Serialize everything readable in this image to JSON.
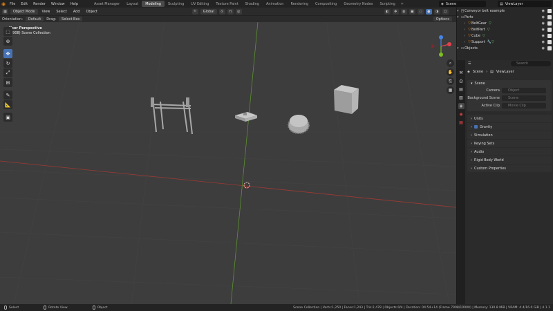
{
  "menu": [
    "File",
    "Edit",
    "Render",
    "Window",
    "Help"
  ],
  "workspaces": [
    "Asset Manager",
    "Layout",
    "Modeling",
    "Sculpting",
    "UV Editing",
    "Texture Paint",
    "Shading",
    "Animation",
    "Rendering",
    "Compositing",
    "Geometry Nodes",
    "Scripting"
  ],
  "active_workspace": "Modeling",
  "scene_name": "Scene",
  "view_layer": "ViewLayer",
  "viewport": {
    "mode": "Object Mode",
    "menus": [
      "View",
      "Select",
      "Add",
      "Object"
    ],
    "orientation_label": "Orientation:",
    "orientation_value": "Default",
    "drag_label": "Drag:",
    "drag_value": "Select Box",
    "transform_orientation": "Global",
    "options": "Options",
    "perspective": "User Perspective",
    "collection": "(7908) Scene Collection"
  },
  "outliner": {
    "rows": [
      {
        "label": "Conveyor belt example",
        "level": 0,
        "icon": "scene-icon"
      },
      {
        "label": "Parts",
        "level": 0,
        "icon": "collection-icon"
      },
      {
        "label": "BeltGear",
        "level": 1,
        "icon": "mesh-icon"
      },
      {
        "label": "BeltPart",
        "level": 1,
        "icon": "mesh-icon"
      },
      {
        "label": "Cube",
        "level": 1,
        "icon": "mesh-icon"
      },
      {
        "label": "Support",
        "level": 1,
        "icon": "mesh-icon"
      },
      {
        "label": "Objects",
        "level": 0,
        "icon": "collection-icon"
      }
    ]
  },
  "properties": {
    "search_placeholder": "Search",
    "crumb_scene": "Scene",
    "crumb_layer": "ViewLayer",
    "scene_panel": "Scene",
    "fields": [
      {
        "label": "Camera",
        "value": "Object"
      },
      {
        "label": "Background Scene",
        "value": "Scene"
      },
      {
        "label": "Active Clip",
        "value": "Movie Clip"
      }
    ],
    "subpanels": [
      "Units",
      "Gravity",
      "Simulation",
      "Keying Sets",
      "Audio",
      "Rigid Body World",
      "Custom Properties"
    ]
  },
  "status": {
    "select": "Select",
    "rotate": "Rotate View",
    "object": "Object",
    "info": "Scene Collection | Verts:1,250 | Faces:1,243 | Tris:2,478 | Objects:0/4 | Duration: 04:54+14 (Frame 7908/10000) | Memory: 130.8 MiB | VRAM: 4.4/16.0 GiB | 4.1.1"
  },
  "colors": {
    "accent": "#4772b3",
    "active_workspace_bg": "#4a4a4a",
    "x_axis": "#b8453d",
    "y_axis": "#6a9c35",
    "gizmo_x": "#e2414c",
    "gizmo_y": "#7cc021",
    "gizmo_z": "#4685e8"
  }
}
